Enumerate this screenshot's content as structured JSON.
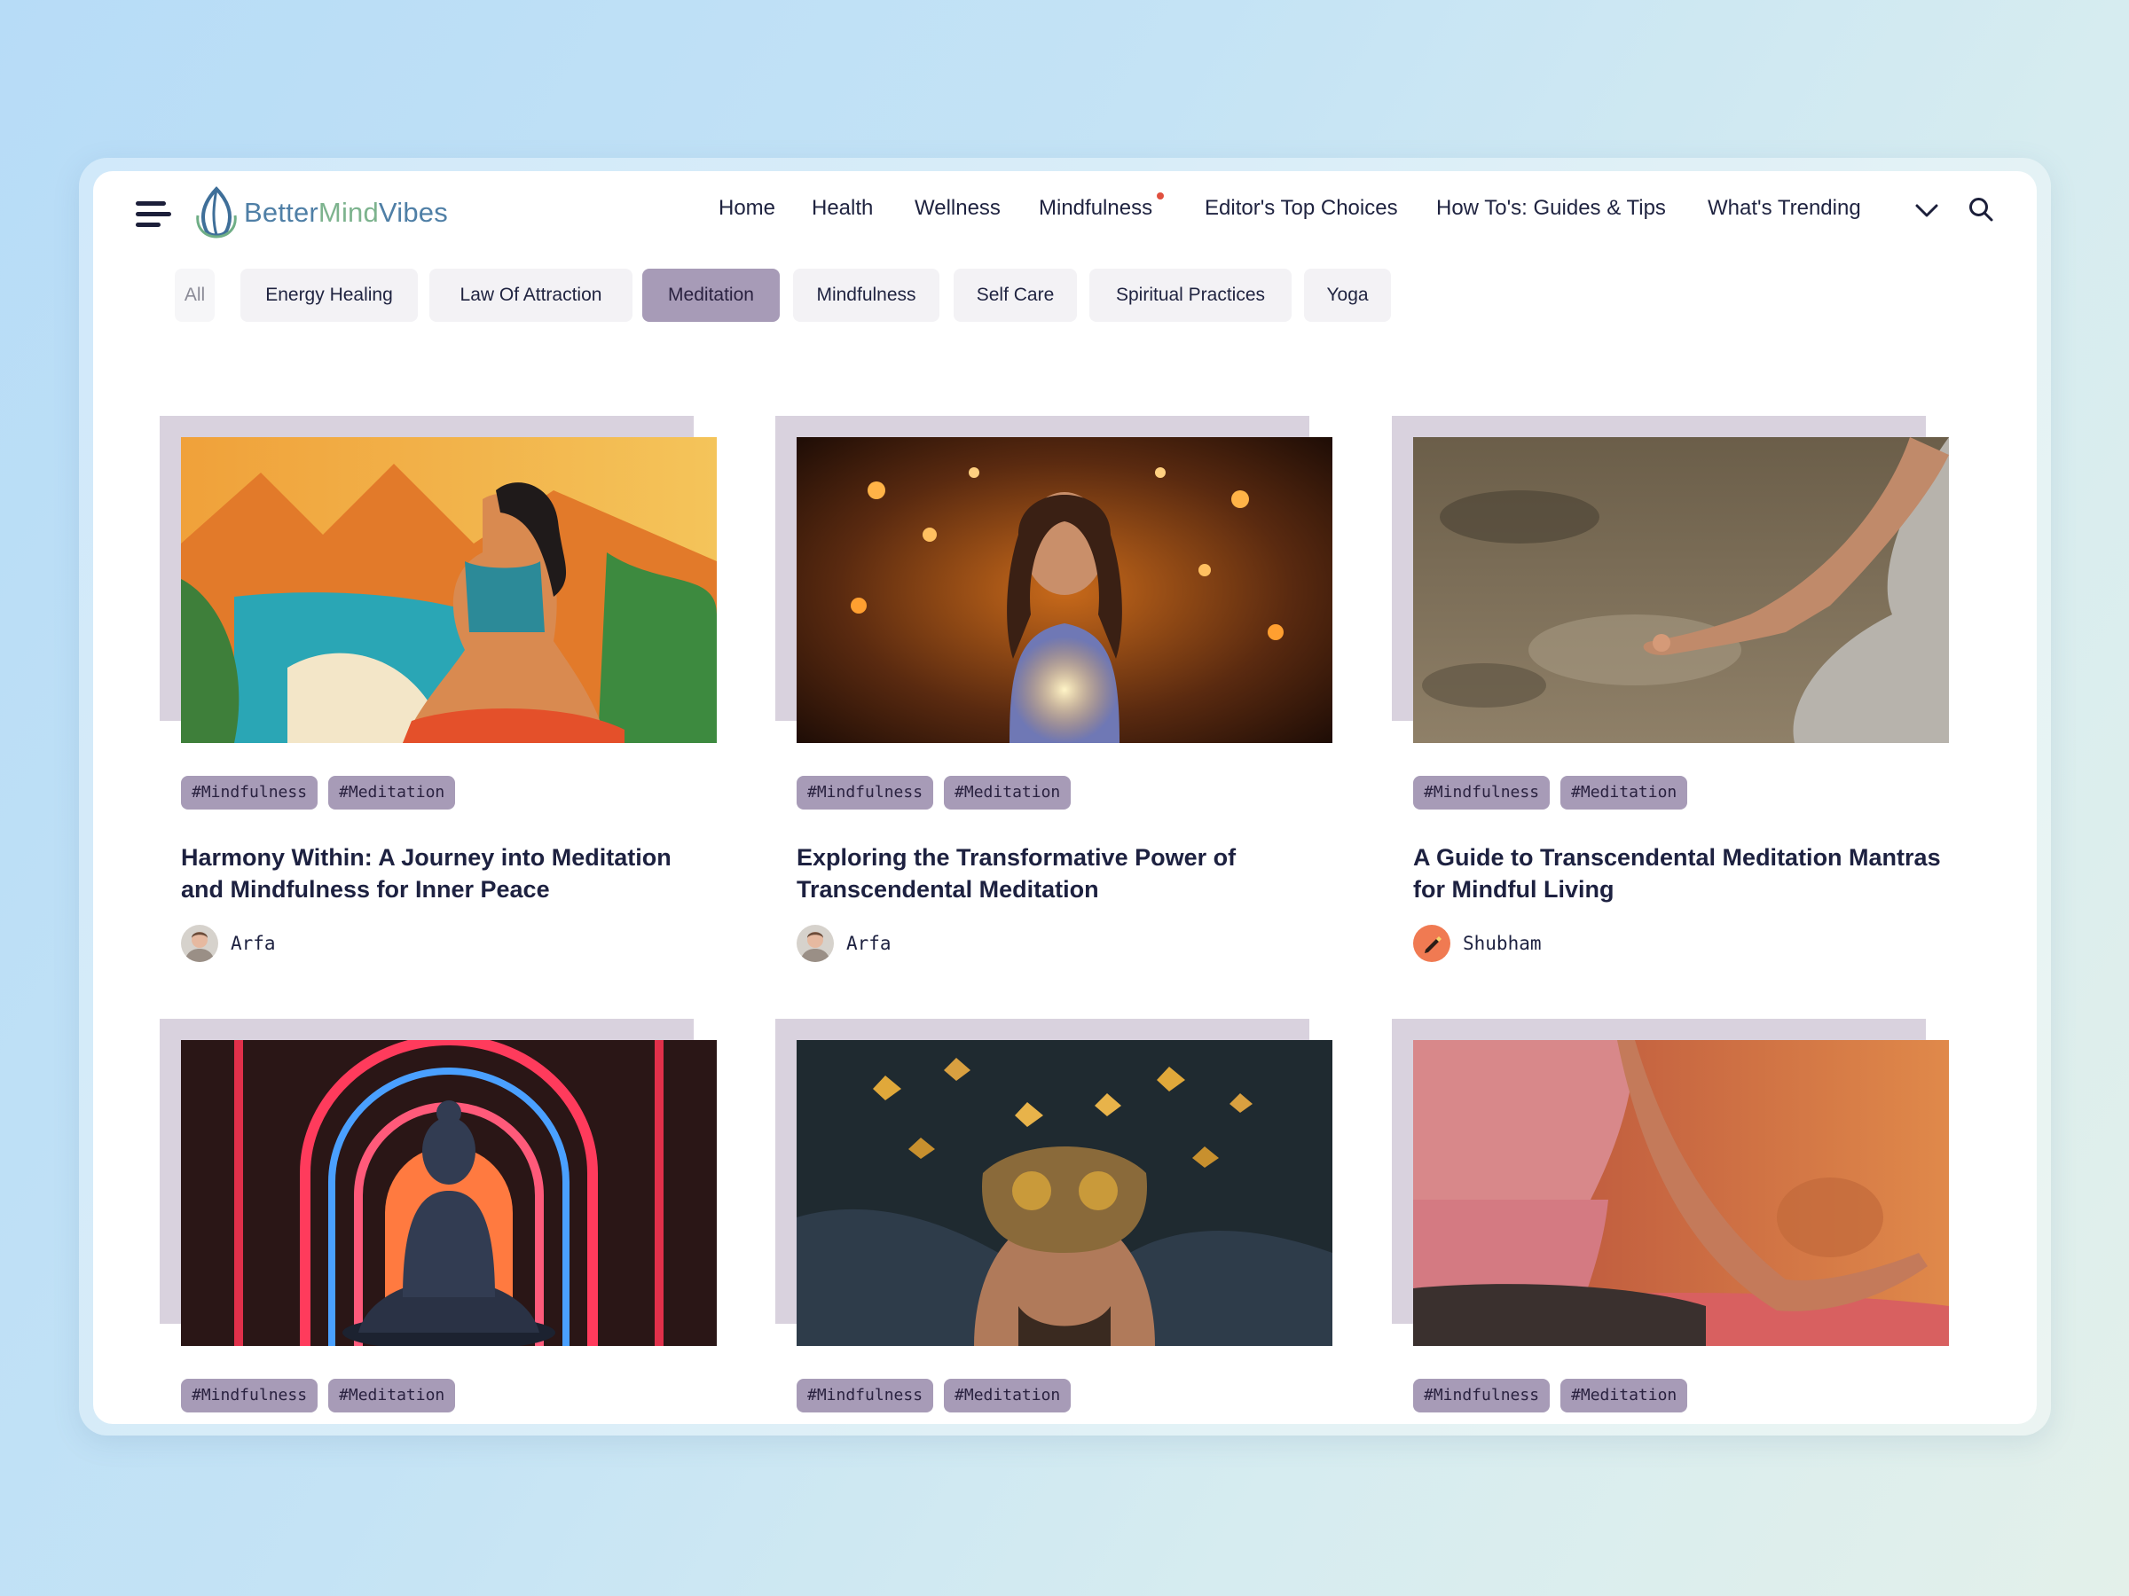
{
  "header": {
    "logo": {
      "part1": "Better",
      "part2": "Mind",
      "part3": "Vibes"
    },
    "nav": [
      "Home",
      "Health",
      "Wellness",
      "Mindfulness",
      "Editor's Top Choices",
      "How To's: Guides & Tips",
      "What's Trending"
    ],
    "nav_dot_item": "Mindfulness"
  },
  "categories": [
    "All",
    "Energy Healing",
    "Law Of Attraction",
    "Meditation",
    "Mindfulness",
    "Self Care",
    "Spiritual Practices",
    "Yoga"
  ],
  "active_category": "Meditation",
  "colors": {
    "accent": "#a79bb7",
    "text": "#1d2140",
    "backdrop": "#d9d2de",
    "nav_dot": "#e0503f"
  },
  "articles": [
    {
      "image": "woman-meditating-landscape-illustration",
      "tags": [
        "#Mindfulness",
        "#Meditation"
      ],
      "title": "Harmony Within: A Journey into Meditation and Mindfulness for Inner Peace",
      "author": "Arfa"
    },
    {
      "image": "woman-glowing-lights",
      "tags": [
        "#Mindfulness",
        "#Meditation"
      ],
      "title": "Exploring the Transformative Power of Transcendental Meditation",
      "author": "Arfa"
    },
    {
      "image": "hand-mudra-beach",
      "tags": [
        "#Mindfulness",
        "#Meditation"
      ],
      "title": "A Guide to Transcendental Meditation Mantras for Mindful Living",
      "author": "Shubham"
    },
    {
      "image": "buddha-neon-arches",
      "tags": [
        "#Mindfulness",
        "#Meditation"
      ],
      "title": "",
      "author": ""
    },
    {
      "image": "man-butterflies-face",
      "tags": [
        "#Mindfulness",
        "#Meditation"
      ],
      "title": "",
      "author": ""
    },
    {
      "image": "yoga-pose-hand",
      "tags": [
        "#Mindfulness",
        "#Meditation"
      ],
      "title": "",
      "author": ""
    }
  ]
}
